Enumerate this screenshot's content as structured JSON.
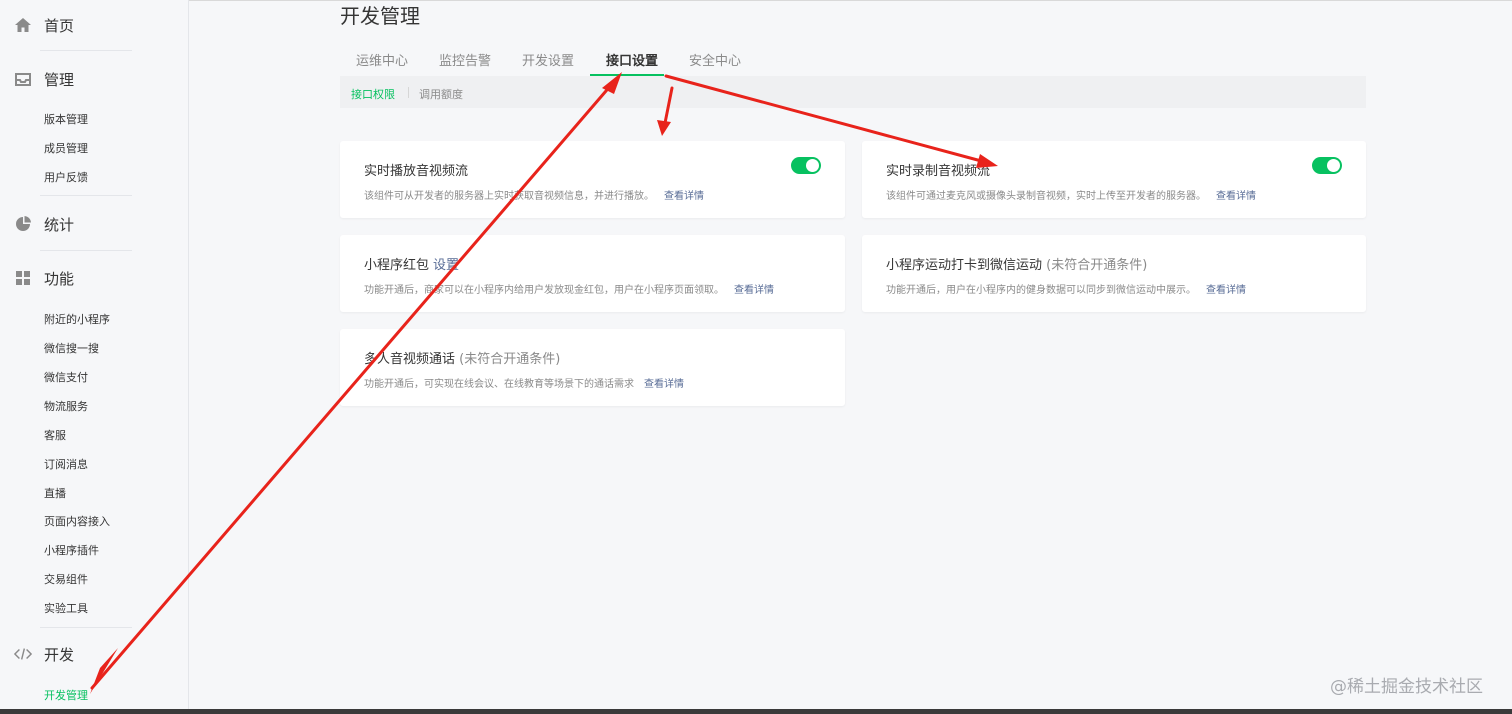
{
  "sidebar": {
    "home": {
      "label": "首页",
      "icon": "home-icon"
    },
    "manage": {
      "label": "管理",
      "icon": "inbox-icon",
      "items": [
        "版本管理",
        "成员管理",
        "用户反馈"
      ]
    },
    "stats": {
      "label": "统计",
      "icon": "pie-chart-icon"
    },
    "features": {
      "label": "功能",
      "icon": "grid-icon",
      "items": [
        "附近的小程序",
        "微信搜一搜",
        "微信支付",
        "物流服务",
        "客服",
        "订阅消息",
        "直播",
        "页面内容接入",
        "小程序插件",
        "交易组件",
        "实验工具"
      ]
    },
    "dev": {
      "label": "开发",
      "icon": "code-icon",
      "items": [
        "开发管理"
      ],
      "active_item": "开发管理"
    }
  },
  "main": {
    "title": "开发管理",
    "tabs": [
      "运维中心",
      "监控告警",
      "开发设置",
      "接口设置",
      "安全中心"
    ],
    "active_tab": "接口设置",
    "subtabs": [
      "接口权限",
      "调用额度"
    ],
    "active_subtab": "接口权限",
    "cards": [
      {
        "title": "实时播放音视频流",
        "desc": "该组件可从开发者的服务器上实时获取音视频信息，并进行播放。",
        "link": "查看详情",
        "toggle": "on"
      },
      {
        "title": "实时录制音视频流",
        "desc": "该组件可通过麦克风或摄像头录制音视频，实时上传至开发者的服务器。",
        "link": "查看详情",
        "toggle": "on"
      },
      {
        "title": "小程序红包",
        "setting": "设置",
        "desc": "功能开通后，商家可以在小程序内给用户发放现金红包，用户在小程序页面领取。",
        "link": "查看详情"
      },
      {
        "title": "小程序运动打卡到微信运动",
        "note": "(未符合开通条件)",
        "desc": "功能开通后，用户在小程序内的健身数据可以同步到微信运动中展示。",
        "link": "查看详情"
      },
      {
        "title": "多人音视频通话",
        "note": "(未符合开通条件)",
        "desc": "功能开通后，可实现在线会议、在线教育等场景下的通话需求",
        "link": "查看详情"
      }
    ]
  },
  "watermark": "@稀土掘金技术社区",
  "colors": {
    "accent": "#07c160",
    "link": "#576b95",
    "annotation": "#e8231b"
  }
}
